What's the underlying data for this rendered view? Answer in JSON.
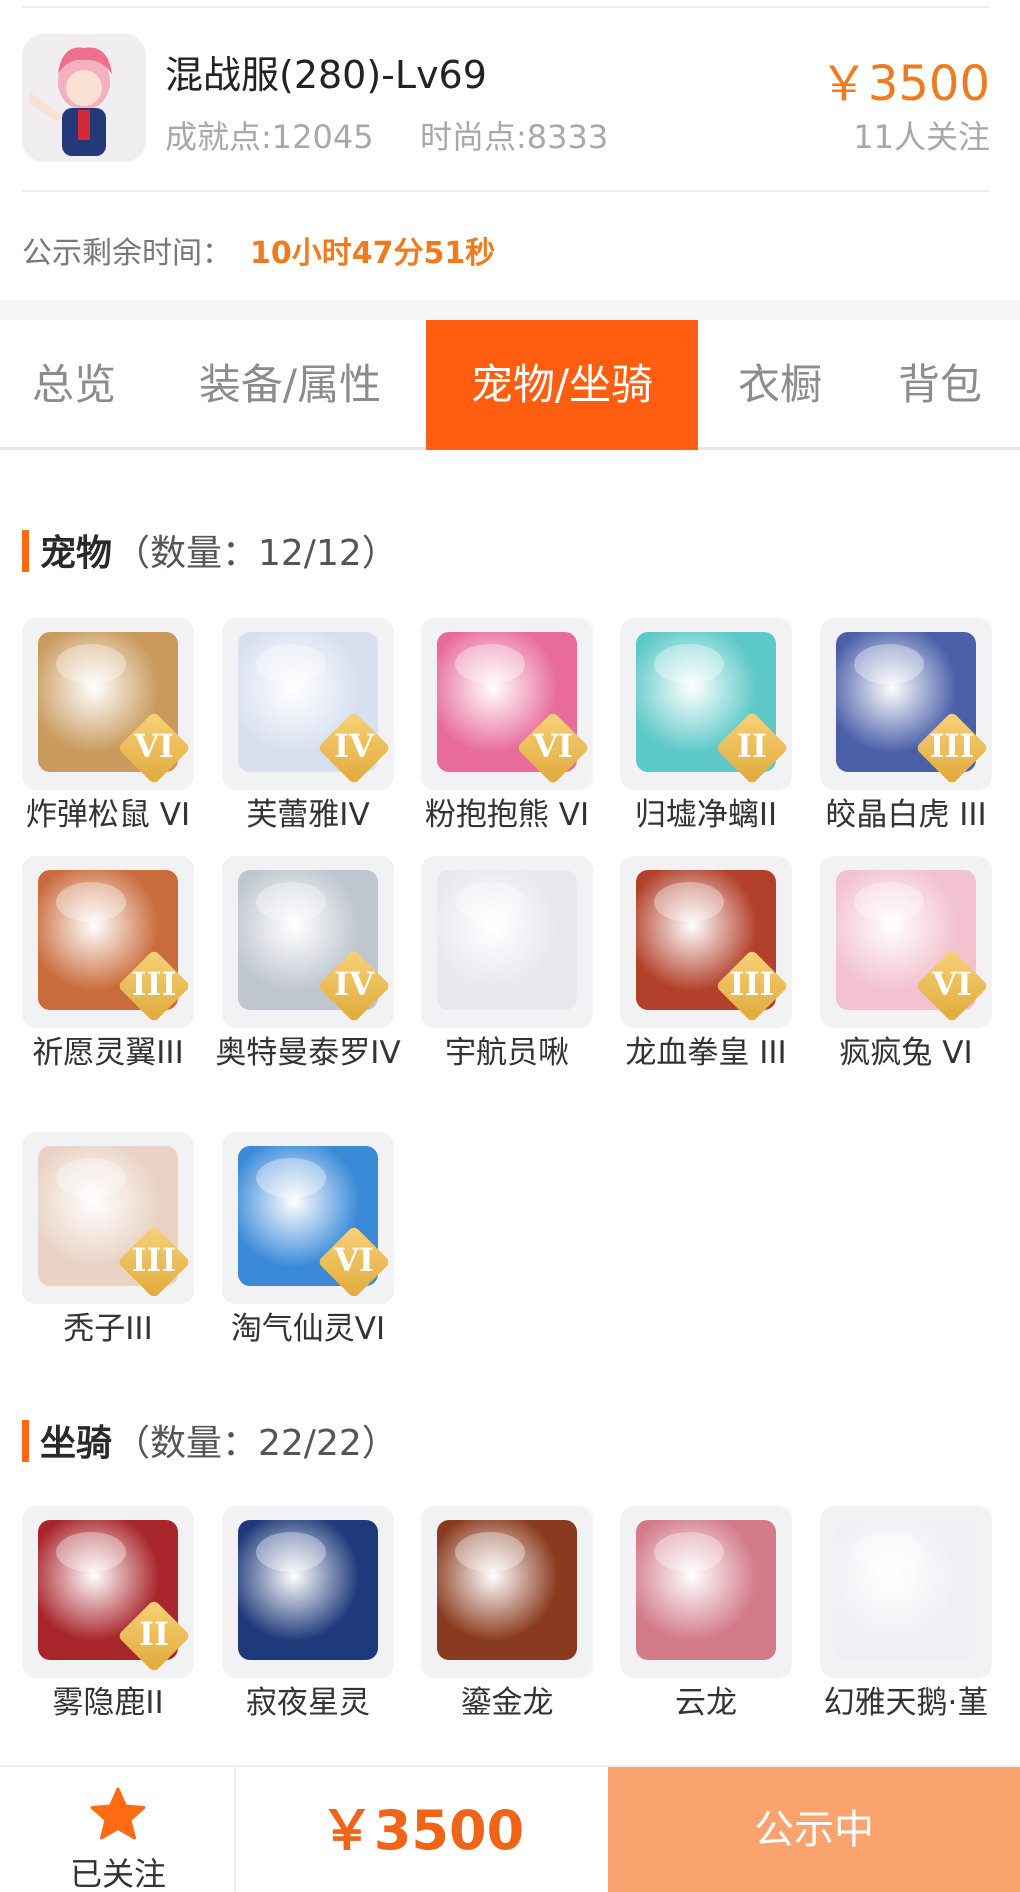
{
  "listing": {
    "title": "混战服(280)-Lv69",
    "achievement": "成就点:12045",
    "fashion": "时尚点:8333",
    "price": "￥3500",
    "followers": "11人关注",
    "countdown_label": "公示剩余时间：",
    "countdown_value": "10小时47分51秒"
  },
  "tabs": [
    {
      "label": "总览",
      "active": false
    },
    {
      "label": "装备/属性",
      "active": false
    },
    {
      "label": "宠物/坐骑",
      "active": true
    },
    {
      "label": "衣橱",
      "active": false
    },
    {
      "label": "背包",
      "active": false
    }
  ],
  "pets": {
    "title": "宠物",
    "count": "（数量：12/12）",
    "items": [
      {
        "name": "炸弹松鼠 VI",
        "badge": "VI",
        "color": "#c99a5c"
      },
      {
        "name": "芙蕾雅IV",
        "badge": "IV",
        "color": "#d8e0f0"
      },
      {
        "name": "粉抱抱熊 VI",
        "badge": "VI",
        "color": "#e86b9a"
      },
      {
        "name": "归墟净螭II",
        "badge": "II",
        "color": "#5cc9c8"
      },
      {
        "name": "皎晶白虎 III",
        "badge": "III",
        "color": "#4a5fa8"
      },
      {
        "name": "祈愿灵翼III",
        "badge": "III",
        "color": "#c96b3a"
      },
      {
        "name": "奥特曼泰罗IV",
        "badge": "IV",
        "color": "#c0c6d0"
      },
      {
        "name": "宇航员啾",
        "badge": "",
        "color": "#e6e8ee"
      },
      {
        "name": "龙血拳皇 III",
        "badge": "III",
        "color": "#b2402a"
      },
      {
        "name": "疯疯兔 VI",
        "badge": "VI",
        "color": "#f2c2d0"
      },
      {
        "name": "秃子III",
        "badge": "III",
        "color": "#e9d2c4"
      },
      {
        "name": "淘气仙灵VI",
        "badge": "VI",
        "color": "#3a8ad8"
      }
    ]
  },
  "mounts": {
    "title": "坐骑",
    "count": "（数量：22/22）",
    "items": [
      {
        "name": "雾隐鹿II",
        "badge": "II",
        "color": "#a8252c"
      },
      {
        "name": "寂夜星灵",
        "badge": "",
        "color": "#1f3a7a"
      },
      {
        "name": "鎏金龙",
        "badge": "",
        "color": "#8a3a1e"
      },
      {
        "name": "云龙",
        "badge": "",
        "color": "#d27a8a"
      },
      {
        "name": "幻雅天鹅·堇",
        "badge": "",
        "color": "#eef0f4"
      }
    ]
  },
  "bottom": {
    "fav_label": "已关注",
    "price": "￥3500",
    "status": "公示中"
  },
  "colors": {
    "accent": "#ff5e11",
    "price": "#f07b1e",
    "badge_gold": "#e0a93a",
    "status_button": "#fba36f"
  }
}
